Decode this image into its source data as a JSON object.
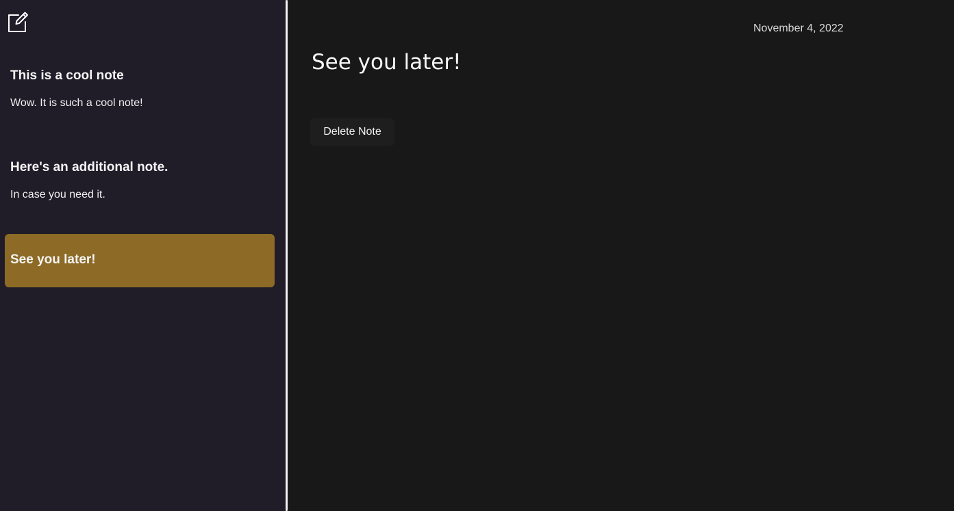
{
  "colors": {
    "sidebar_bg": "#201d29",
    "main_bg": "#181818",
    "selected_note_bg": "#8d6b26",
    "divider": "#f2f2f2",
    "text": "#f4f4f4"
  },
  "sidebar": {
    "new_note_icon": "edit-square-icon",
    "notes": [
      {
        "title": "This is a cool note",
        "preview": "Wow. It is such a cool note!",
        "selected": false
      },
      {
        "title": "Here's an additional note.",
        "preview": "In case you need it.",
        "selected": false
      },
      {
        "title": "See you later!",
        "preview": "",
        "selected": true
      }
    ]
  },
  "main": {
    "date": "November 4, 2022",
    "title": "See you later!",
    "delete_label": "Delete Note"
  }
}
